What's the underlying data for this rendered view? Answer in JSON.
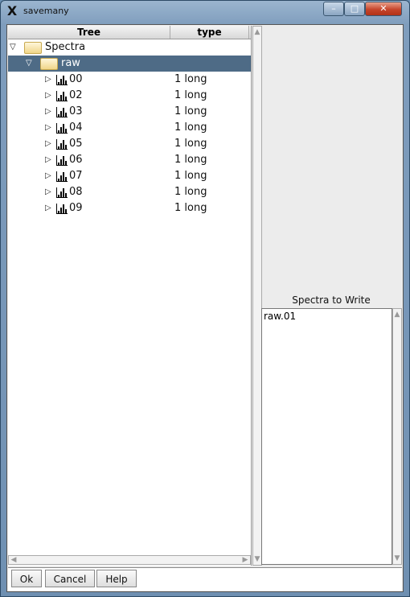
{
  "window": {
    "title": "savemany",
    "app_icon": "x11-icon",
    "controls": [
      "minimize",
      "maximize",
      "close"
    ]
  },
  "tree": {
    "columns": [
      "Tree",
      "type"
    ],
    "root": {
      "label": "Spectra",
      "expander": "▽"
    },
    "folder": {
      "label": "raw",
      "expander": "▽"
    },
    "items": [
      {
        "name": "00",
        "type": "1 long"
      },
      {
        "name": "02",
        "type": "1 long"
      },
      {
        "name": "03",
        "type": "1 long"
      },
      {
        "name": "04",
        "type": "1 long"
      },
      {
        "name": "05",
        "type": "1 long"
      },
      {
        "name": "06",
        "type": "1 long"
      },
      {
        "name": "07",
        "type": "1 long"
      },
      {
        "name": "08",
        "type": "1 long"
      },
      {
        "name": "09",
        "type": "1 long"
      }
    ]
  },
  "spectra_to_write": {
    "title": "Spectra to Write",
    "items": [
      "raw.01"
    ]
  },
  "buttons": {
    "ok": "Ok",
    "cancel": "Cancel",
    "help": "Help"
  },
  "colors": {
    "selection": "#4e6b86",
    "window_frame": "#7f9dbd"
  }
}
